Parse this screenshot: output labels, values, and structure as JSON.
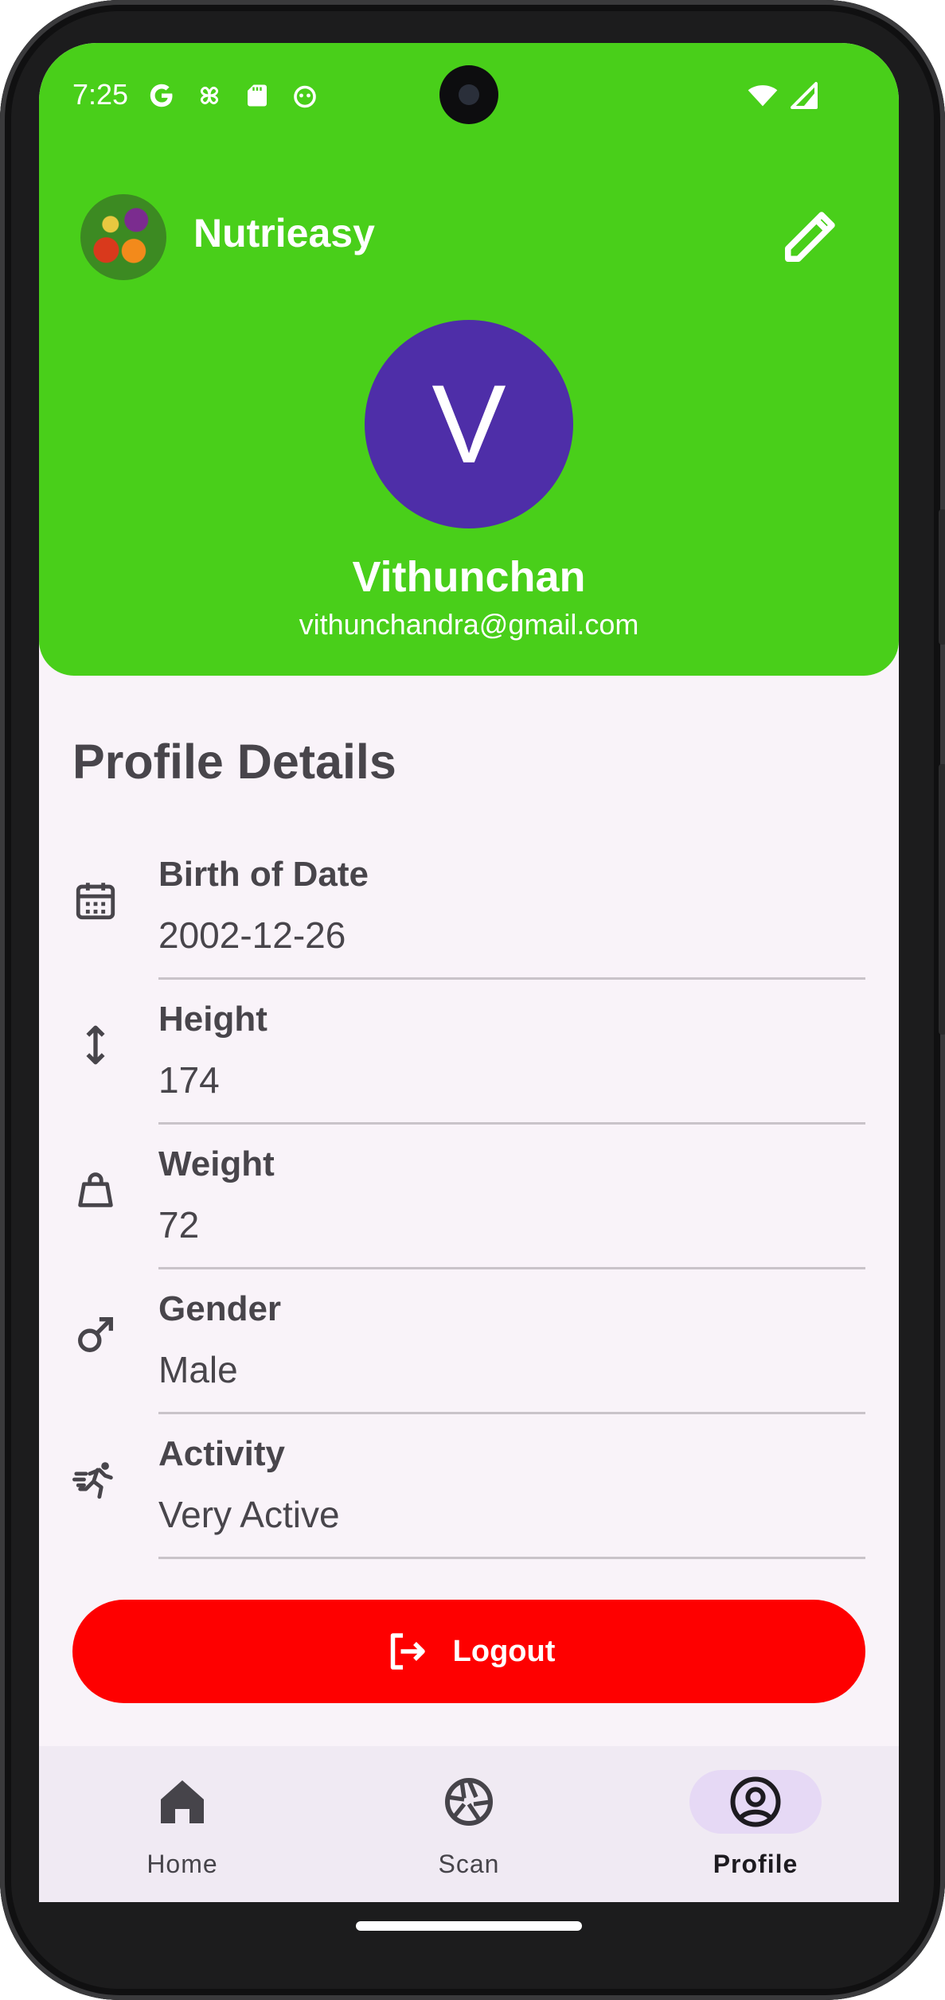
{
  "status_bar": {
    "time": "7:25"
  },
  "app": {
    "name": "Nutrieasy"
  },
  "user": {
    "initial": "V",
    "name": "Vithunchan",
    "email": "vithunchandra@gmail.com"
  },
  "profile": {
    "section_title": "Profile Details",
    "fields": [
      {
        "label": "Birth of Date",
        "value": "2002-12-26",
        "icon": "calendar-icon"
      },
      {
        "label": "Height",
        "value": "174",
        "icon": "height-arrows-icon"
      },
      {
        "label": "Weight",
        "value": "72",
        "icon": "weight-bag-icon"
      },
      {
        "label": "Gender",
        "value": "Male",
        "icon": "male-icon"
      },
      {
        "label": "Activity",
        "value": "Very Active",
        "icon": "running-icon"
      }
    ]
  },
  "logout_label": "Logout",
  "colors": {
    "header": "#49cf1a",
    "avatar": "#4e2ea8",
    "logout": "#fe0000",
    "nav_active": "#e6d9f5"
  },
  "nav": [
    {
      "label": "Home",
      "icon": "home-icon"
    },
    {
      "label": "Scan",
      "icon": "camera-shutter-icon"
    },
    {
      "label": "Profile",
      "icon": "account-circle-icon",
      "active": true
    }
  ]
}
